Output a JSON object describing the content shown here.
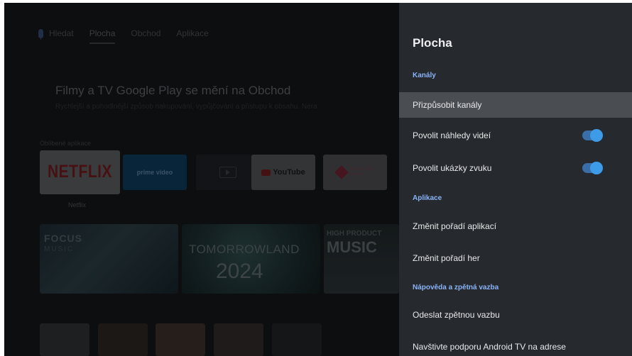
{
  "home": {
    "nav": {
      "search": "Hledat",
      "tabs": [
        "Plocha",
        "Obchod",
        "Aplikace"
      ],
      "active_tab": "Plocha"
    },
    "promo": {
      "title": "Filmy a TV Google Play se mění na Obchod",
      "subtitle": "Rychlejší a pohodlnější způsob nakupování, vypůjčování a přístupu k obsahu. Nera"
    },
    "favorites_label": "Oblíbené aplikace",
    "apps": {
      "netflix": "NETFLIX",
      "prime": "prime video",
      "youtube": "YouTube",
      "google_play": "Google Play\nMovies",
      "focused_app_name": "Netflix"
    },
    "banners": {
      "focus_title": "FOCUS",
      "focus_sub": "MUSIC",
      "tomorrowland_title": "TOMORROWLAND",
      "tomorrowland_year": "2024",
      "music_title": "HIGH PRODUCT",
      "music_sub": "MUSIC"
    }
  },
  "panel": {
    "title": "Plocha",
    "sections": {
      "channels": "Kanály",
      "apps": "Aplikace",
      "help": "Nápověda a zpětná vazba"
    },
    "items": {
      "customize_channels": "Přizpůsobit kanály",
      "video_previews": "Povolit náhledy videí",
      "audio_previews": "Povolit ukázky zvuku",
      "reorder_apps": "Změnit pořadí aplikací",
      "reorder_games": "Změnit pořadí her",
      "send_feedback": "Odeslat zpětnou vazbu",
      "visit_support": "Navštivte podporu Android TV na adrese"
    },
    "toggles": {
      "video_previews": true,
      "audio_previews": true
    }
  },
  "colors": {
    "panel_bg": "#26292d",
    "section_accent": "#8ab4f8",
    "toggle_on": "#3d9be8",
    "focused_row": "#4a4d51"
  }
}
